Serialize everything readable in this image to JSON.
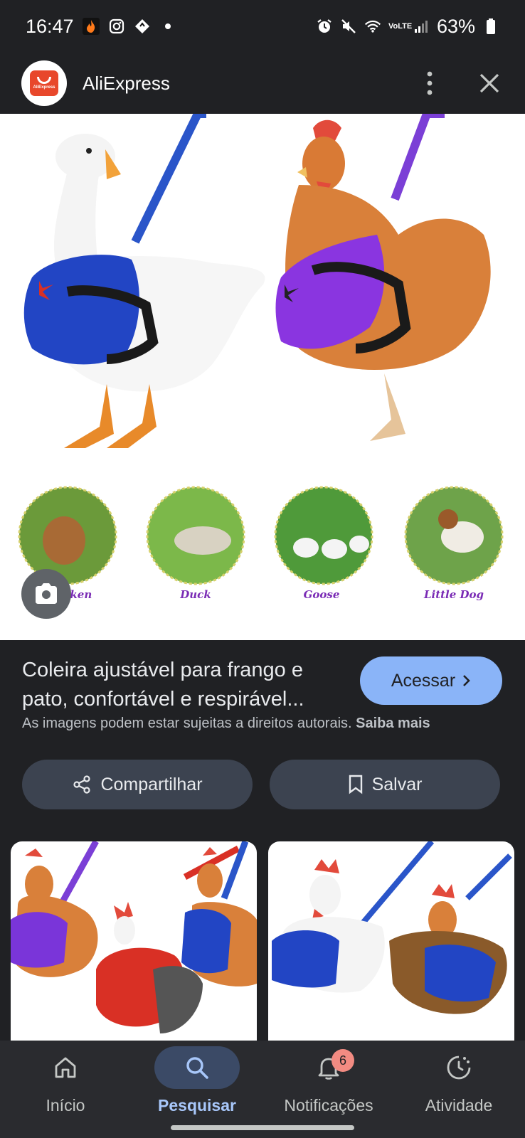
{
  "status_bar": {
    "time": "16:47",
    "battery": "63%",
    "network": "VoLTE"
  },
  "header": {
    "app_title": "AliExpress",
    "logo_text": "AliExpress"
  },
  "image_labels": {
    "chicken": "Chicken",
    "duck": "Duck",
    "goose": "Goose",
    "dog": "Little Dog"
  },
  "result": {
    "title": "Coleira ajustável para frango e pato, confortável e respirável...",
    "visit_label": "Acessar",
    "copyright_text": "As imagens podem estar sujeitas a direitos autorais.",
    "learn_more": "Saiba mais"
  },
  "actions": {
    "share_label": "Compartilhar",
    "save_label": "Salvar"
  },
  "bottom_nav": {
    "items": [
      {
        "label": "Início",
        "icon": "home-icon"
      },
      {
        "label": "Pesquisar",
        "icon": "search-icon",
        "active": true
      },
      {
        "label": "Notificações",
        "icon": "bell-icon",
        "badge": "6"
      },
      {
        "label": "Atividade",
        "icon": "activity-icon"
      }
    ]
  },
  "colors": {
    "accent": "#8ab4f8",
    "background": "#202124",
    "button": "#3c4350",
    "badge": "#f28b82"
  }
}
